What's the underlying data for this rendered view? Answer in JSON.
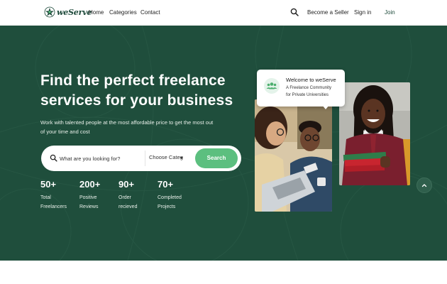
{
  "nav": {
    "logo_text": "weServe",
    "links": [
      "Home",
      "Categories",
      "Contact"
    ],
    "search_icon": "search-icon",
    "become_seller": "Become a Seller",
    "sign_in": "Sign in",
    "join": "Join"
  },
  "hero": {
    "headline_line1": "Find the perfect freelance",
    "headline_line2": "services for your business",
    "subtext": "Work with talented people at the most affordable price to get the most out of your time and cost",
    "search": {
      "placeholder": "What are you looking for?",
      "category_value": "Choose Categ",
      "button_label": "Search"
    },
    "stats": [
      {
        "value": "50+",
        "label": "Total Freelancers"
      },
      {
        "value": "200+",
        "label": "Positive Reviews"
      },
      {
        "value": "90+",
        "label": "Order recieved"
      },
      {
        "value": "70+",
        "label": "Completed Projects"
      }
    ],
    "welcome_card": {
      "title": "Welcome to weServe",
      "line1": "A Freelance Community",
      "line2": "for Private Universities"
    }
  },
  "colors": {
    "hero_bg": "#1f4e3c",
    "accent": "#5cbf7f",
    "brand_dark": "#1e4a3b"
  }
}
